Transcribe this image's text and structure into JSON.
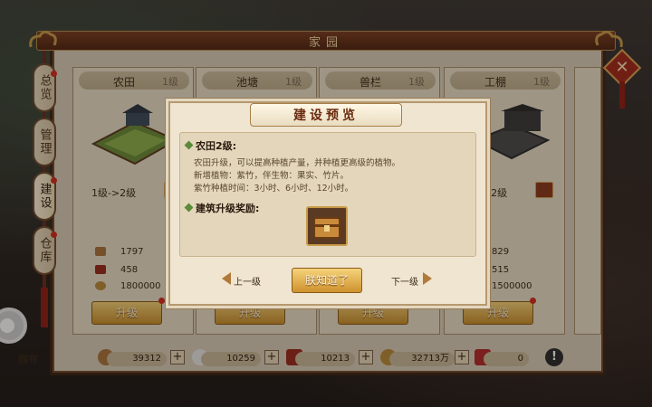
{
  "window": {
    "title": "家园"
  },
  "side_tabs": [
    {
      "label": "总览",
      "has_badge": true
    },
    {
      "label": "管理",
      "has_badge": false
    },
    {
      "label": "建设",
      "has_badge": true
    },
    {
      "label": "仓库",
      "has_badge": true
    }
  ],
  "cards": [
    {
      "name": "农田",
      "level": "1级",
      "upgrade": "1级->2级",
      "costs": [
        "1797",
        "458",
        "1800000"
      ],
      "button": "升级"
    },
    {
      "name": "池塘",
      "level": "1级",
      "upgrade": "",
      "costs": [
        "",
        "",
        ""
      ],
      "button": "升级"
    },
    {
      "name": "兽栏",
      "level": "1级",
      "upgrade": "",
      "costs": [
        "",
        "",
        ""
      ],
      "button": "升级"
    },
    {
      "name": "工棚",
      "level": "1级",
      "upgrade": "1级->2级",
      "costs": [
        "829",
        "515",
        "1500000"
      ],
      "button": "升级"
    }
  ],
  "resources": {
    "label": "拥有",
    "items": [
      {
        "value": "39312",
        "icon": "wood-icon",
        "color": "#a9743e"
      },
      {
        "value": "10259",
        "icon": "stone-icon",
        "color": "#e6e6e6"
      },
      {
        "value": "10213",
        "icon": "ore-icon",
        "color": "#9a2a1e"
      },
      {
        "value": "32713万",
        "icon": "coin-icon",
        "color": "#b88a3a"
      },
      {
        "value": "0",
        "icon": "item-icon",
        "color": "#b32a2a"
      }
    ]
  },
  "popup": {
    "title": "建设预览",
    "section_title": "农田2级:",
    "lines": [
      "农田升级，可以提高种植产量，并种植更高级的植物。",
      "新增植物：紫竹，伴生物：果实、竹片。",
      "紫竹种植时间：3小时、6小时、12小时。"
    ],
    "reward_title": "建筑升级奖励:",
    "reward_icon": "treasure-chest-icon",
    "prev_label": "上一级",
    "ok_label": "朕知道了",
    "next_label": "下一级"
  },
  "colors": {
    "accent_red": "#d32a1e",
    "title_bar": "#7a3d21",
    "button_gold": "#e0a848"
  }
}
